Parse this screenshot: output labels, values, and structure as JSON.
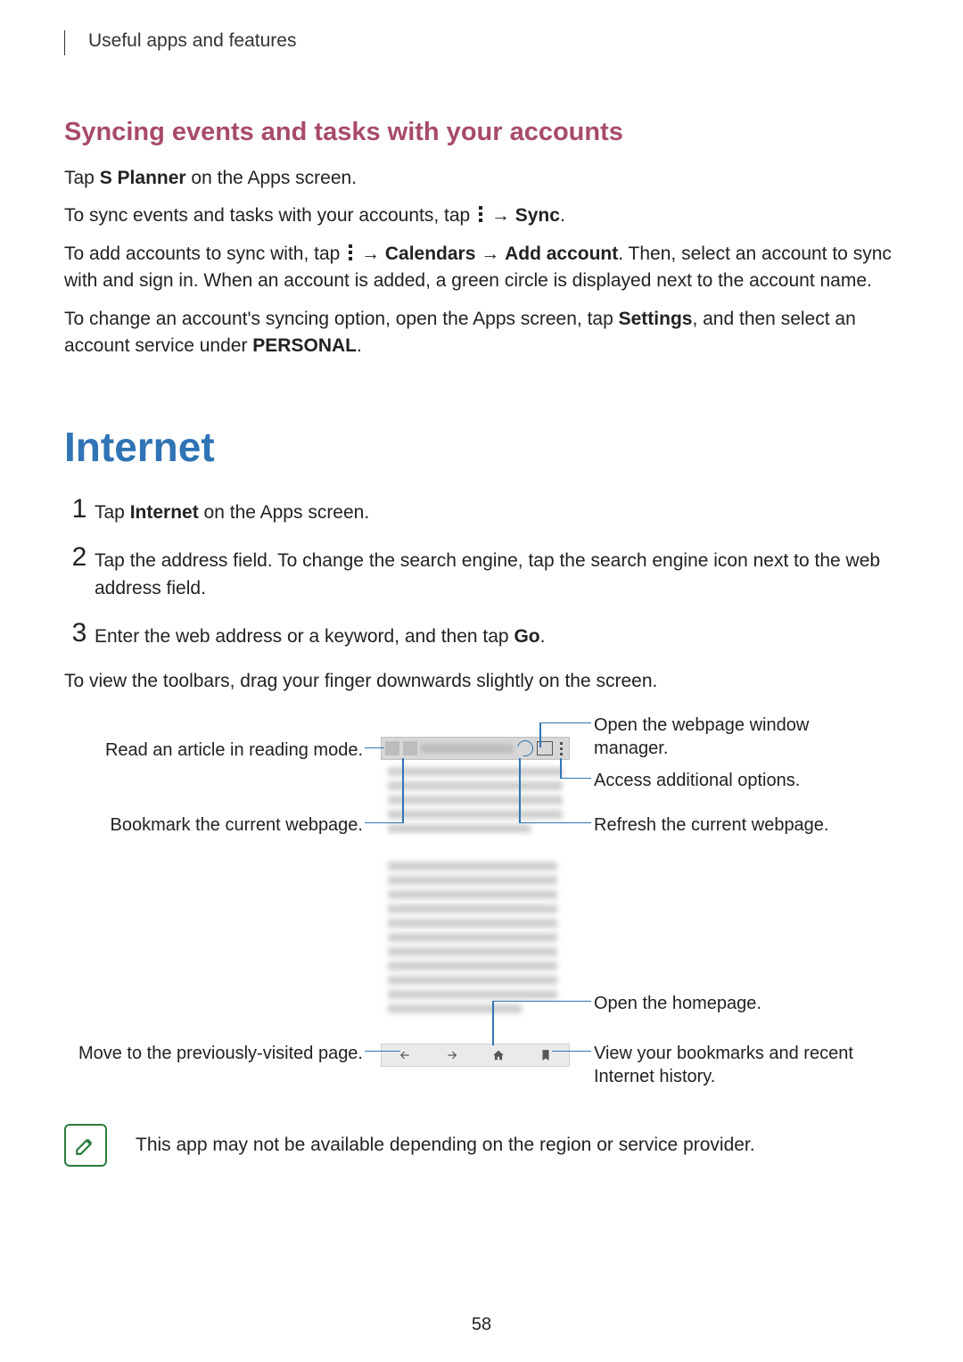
{
  "header": {
    "breadcrumb": "Useful apps and features"
  },
  "syncSection": {
    "title": "Syncing events and tasks with your accounts",
    "p1_a": "Tap ",
    "p1_b": "S Planner",
    "p1_c": " on the Apps screen.",
    "p2_a": "To sync events and tasks with your accounts, tap ",
    "p2_b": " → ",
    "p2_c": "Sync",
    "p2_d": ".",
    "p3_a": "To add accounts to sync with, tap ",
    "p3_b": " → ",
    "p3_c": "Calendars",
    "p3_d": " → ",
    "p3_e": "Add account",
    "p3_f": ". Then, select an account to sync with and sign in. When an account is added, a green circle is displayed next to the account name.",
    "p4_a": "To change an account's syncing option, open the Apps screen, tap ",
    "p4_b": "Settings",
    "p4_c": ", and then select an account service under ",
    "p4_d": "PERSONAL",
    "p4_e": "."
  },
  "internetSection": {
    "title": "Internet",
    "step1_a": "Tap ",
    "step1_b": "Internet",
    "step1_c": " on the Apps screen.",
    "step2": "Tap the address field. To change the search engine, tap the search engine icon next to the web address field.",
    "step3_a": "Enter the web address or a keyword, and then tap ",
    "step3_b": "Go",
    "step3_c": ".",
    "afterSteps": "To view the toolbars, drag your finger downwards slightly on the screen.",
    "nums": {
      "n1": "1",
      "n2": "2",
      "n3": "3"
    }
  },
  "callouts": {
    "readMode": "Read an article in reading mode.",
    "bookmark": "Bookmark the current webpage.",
    "prev": "Move to the previously-visited page.",
    "windowMgr": "Open the webpage window manager.",
    "moreOpts": "Access additional options.",
    "refresh": "Refresh the current webpage.",
    "home": "Open the homepage.",
    "history": "View your bookmarks and recent Internet history."
  },
  "note": "This app may not be available depending on the region or service provider.",
  "pageNumber": "58"
}
